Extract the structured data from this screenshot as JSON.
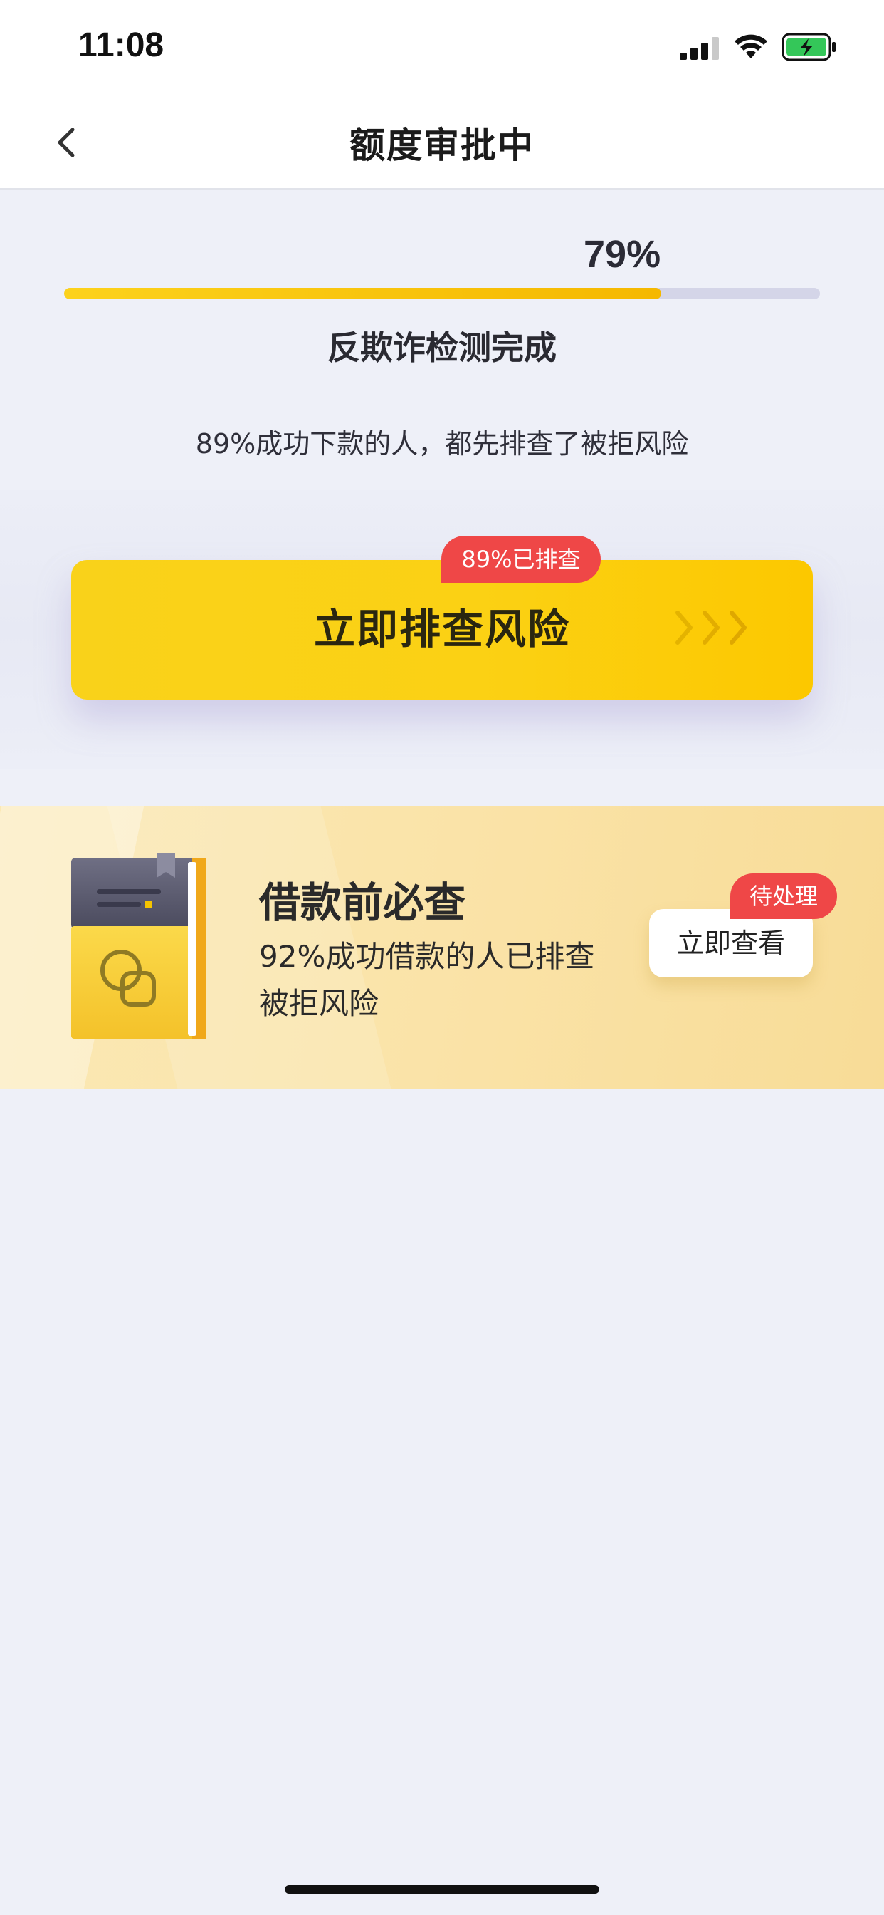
{
  "status_bar": {
    "time": "11:08",
    "icons": [
      "signal-icon",
      "wifi-icon",
      "battery-charging-icon"
    ],
    "battery_color": "#34c759"
  },
  "nav": {
    "title": "额度审批中",
    "back_icon": "chevron-left-icon"
  },
  "progress": {
    "percent_label": "79%",
    "value": 0.79,
    "status": "反欺诈检测完成",
    "fill_color": "#f5c400",
    "track_color": "#d4d5e8"
  },
  "hint": "89%成功下款的人，都先排查了被拒风险",
  "cta": {
    "label": "立即排查风险",
    "badge": "89%已排查",
    "arrows_icon": "triple-chevron-right-icon",
    "color": "#fbd114",
    "badge_color": "#ef4747"
  },
  "loan_card": {
    "icon": "book-icon",
    "title": "借款前必查",
    "desc_line1": "92%成功借款的人已排查",
    "desc_line2": "被拒风险",
    "button_label": "立即查看",
    "badge": "待处理"
  }
}
